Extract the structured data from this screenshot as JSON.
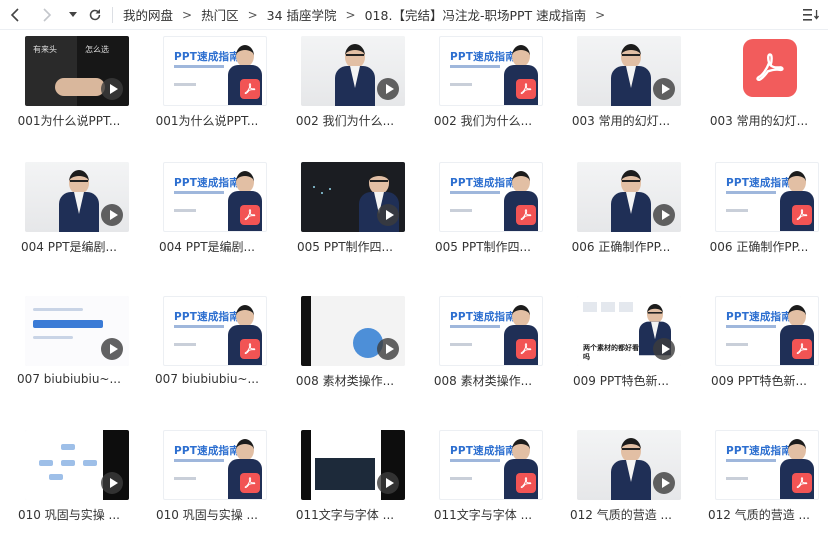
{
  "toolbar": {
    "breadcrumb": [
      "我的网盘",
      "热门区",
      "34 插座学院",
      "018.【完结】冯注龙-职场PPT 速成指南"
    ]
  },
  "thumbs": {
    "pdf_title": "PPT速成指南",
    "dual_left": "有来头",
    "dual_right": "怎么选",
    "grid_caption": "两个素材的都好看吗"
  },
  "files": [
    {
      "name": "001为什么说PPT...",
      "type": "video"
    },
    {
      "name": "001为什么说PPT...",
      "type": "pdf"
    },
    {
      "name": "002 我们为什么...",
      "type": "video"
    },
    {
      "name": "002 我们为什么...",
      "type": "pdf"
    },
    {
      "name": "003 常用的幻灯...",
      "type": "video"
    },
    {
      "name": "003 常用的幻灯...",
      "type": "pdf"
    },
    {
      "name": "004 PPT是编剧...",
      "type": "video"
    },
    {
      "name": "004 PPT是编剧...",
      "type": "pdf"
    },
    {
      "name": "005 PPT制作四...",
      "type": "video"
    },
    {
      "name": "005 PPT制作四...",
      "type": "pdf"
    },
    {
      "name": "006 正确制作PP...",
      "type": "video"
    },
    {
      "name": "006 正确制作PP...",
      "type": "pdf"
    },
    {
      "name": "007 biubiubiu~...",
      "type": "video"
    },
    {
      "name": "007 biubiubiu~...",
      "type": "pdf"
    },
    {
      "name": "008 素材类操作...",
      "type": "video"
    },
    {
      "name": "008 素材类操作...",
      "type": "pdf"
    },
    {
      "name": "009 PPT特色新...",
      "type": "video"
    },
    {
      "name": "009 PPT特色新...",
      "type": "pdf"
    },
    {
      "name": "010 巩固与实操 ...",
      "type": "video"
    },
    {
      "name": "010 巩固与实操 ...",
      "type": "pdf"
    },
    {
      "name": "011文字与字体 ...",
      "type": "video"
    },
    {
      "name": "011文字与字体 ...",
      "type": "pdf"
    },
    {
      "name": "012 气质的营造 ...",
      "type": "video"
    },
    {
      "name": "012 气质的营造 ...",
      "type": "pdf"
    }
  ],
  "colors": {
    "pdf_red": "#f25454",
    "accent_blue": "#2d6fd0"
  }
}
